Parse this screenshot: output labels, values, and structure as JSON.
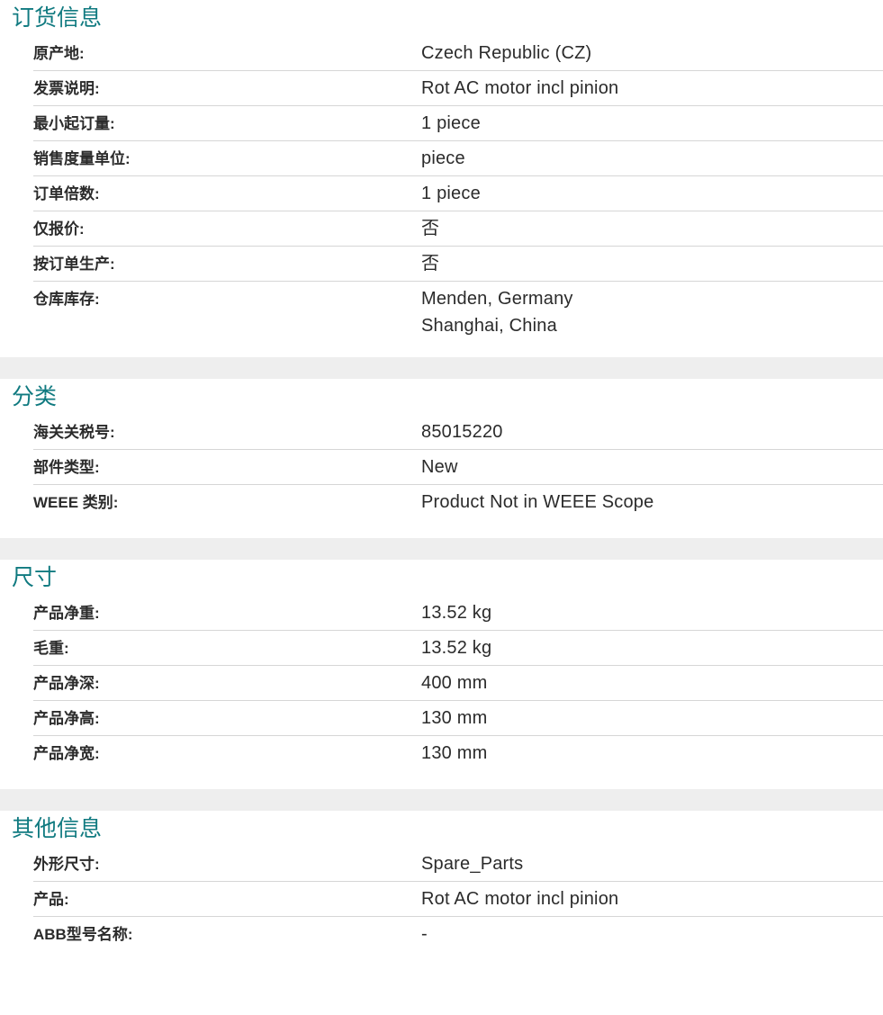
{
  "sections": [
    {
      "title": "订货信息",
      "rows": [
        {
          "label": "原产地:",
          "values": [
            "Czech Republic (CZ)"
          ]
        },
        {
          "label": "发票说明:",
          "values": [
            "Rot AC motor incl pinion"
          ]
        },
        {
          "label": "最小起订量:",
          "values": [
            "1 piece"
          ]
        },
        {
          "label": "销售度量单位:",
          "values": [
            "piece"
          ]
        },
        {
          "label": "订单倍数:",
          "values": [
            "1 piece"
          ]
        },
        {
          "label": "仅报价:",
          "values": [
            "否"
          ]
        },
        {
          "label": "按订单生产:",
          "values": [
            "否"
          ]
        },
        {
          "label": "仓库库存:",
          "values": [
            "Menden, Germany",
            "Shanghai, China"
          ]
        }
      ]
    },
    {
      "title": "分类",
      "rows": [
        {
          "label": "海关关税号:",
          "values": [
            "85015220"
          ]
        },
        {
          "label": "部件类型:",
          "values": [
            "New"
          ]
        },
        {
          "label": "WEEE 类别:",
          "values": [
            "Product Not in WEEE Scope"
          ]
        }
      ]
    },
    {
      "title": "尺寸",
      "rows": [
        {
          "label": "产品净重:",
          "values": [
            "13.52 kg"
          ]
        },
        {
          "label": "毛重:",
          "values": [
            "13.52 kg"
          ]
        },
        {
          "label": "产品净深:",
          "values": [
            "400 mm"
          ]
        },
        {
          "label": "产品净高:",
          "values": [
            "130 mm"
          ]
        },
        {
          "label": "产品净宽:",
          "values": [
            "130 mm"
          ]
        }
      ]
    },
    {
      "title": "其他信息",
      "rows": [
        {
          "label": "外形尺寸:",
          "values": [
            "Spare_Parts"
          ]
        },
        {
          "label": "产品:",
          "values": [
            "Rot AC motor incl pinion"
          ]
        },
        {
          "label": "ABB型号名称:",
          "values": [
            "-"
          ]
        }
      ]
    }
  ]
}
